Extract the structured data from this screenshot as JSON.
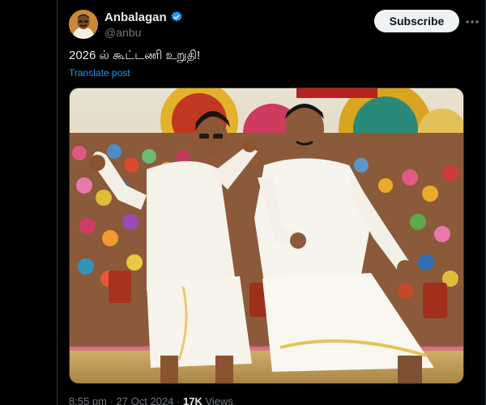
{
  "author": {
    "display_name": "Anbalagan",
    "handle": "@anbu",
    "verified": true,
    "avatar_icon": "profile-avatar"
  },
  "actions": {
    "subscribe_label": "Subscribe",
    "more_icon": "more-icon"
  },
  "post": {
    "text": "2026 ல் கூட்டணி உறுதி!",
    "translate_label": "Translate post"
  },
  "media": {
    "alt_icon": "photo"
  },
  "meta": {
    "time": "8:55 pm",
    "separator": "·",
    "date": "27 Oct 2024",
    "views_count": "17K",
    "views_label": "Views"
  },
  "colors": {
    "background": "#000000",
    "text": "#e7e9ea",
    "secondary": "#71767b",
    "link": "#1d9bf0",
    "verified": "#1d9bf0",
    "button_bg": "#eff3f4"
  }
}
